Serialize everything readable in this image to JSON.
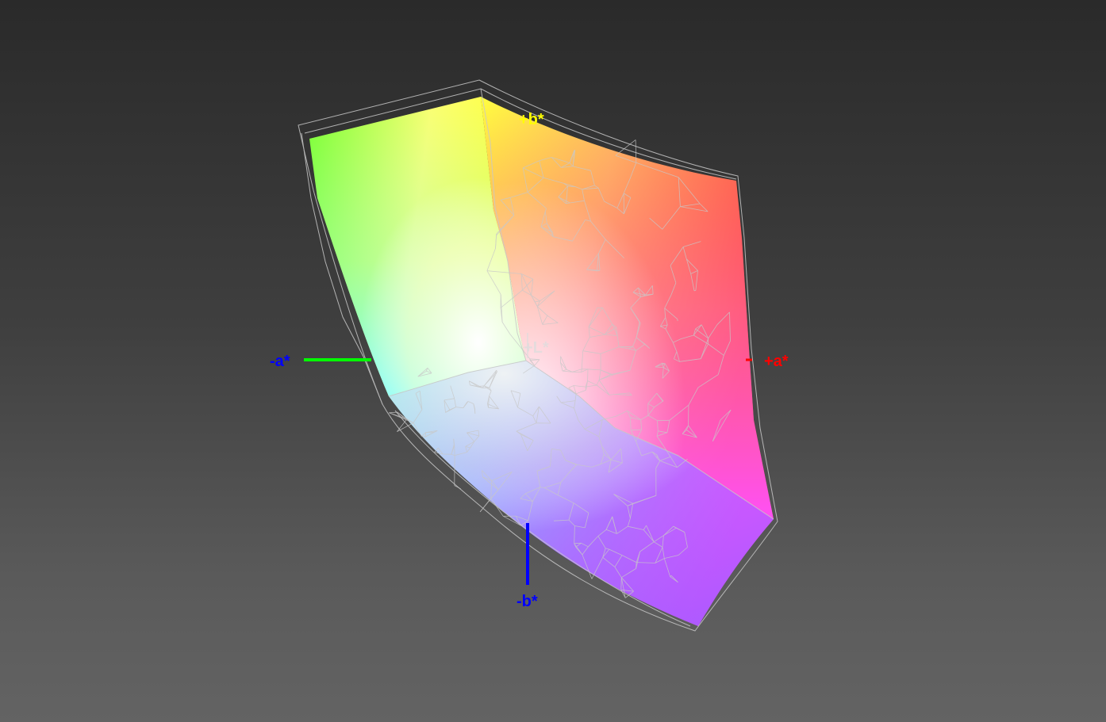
{
  "axes": {
    "neg_a": {
      "label": "-a*",
      "color": "#0000ff"
    },
    "pos_a": {
      "label": "+a*",
      "color": "#ff0000"
    },
    "pos_b": {
      "label": "+b*",
      "color": "#ffff00"
    },
    "neg_b": {
      "label": "-b*",
      "color": "#0000ff"
    },
    "pos_L": {
      "label": "+L*",
      "color": "#dddddd"
    }
  },
  "axis_line_colors": {
    "neg_a_line": "#00ff00",
    "neg_b_line": "#0000ff",
    "pos_a_tick": "#ff0000"
  },
  "gamut": {
    "fill_colors": {
      "yellow": "#ffff00",
      "green": "#66ff33",
      "orange": "#ff6633",
      "red": "#ff3366",
      "magenta": "#ff33ff",
      "violet": "#9966ff",
      "blue": "#66aaff",
      "cyan": "#66ffff",
      "white": "#ffffff"
    },
    "wireframe_color": "#c8c8c8"
  }
}
